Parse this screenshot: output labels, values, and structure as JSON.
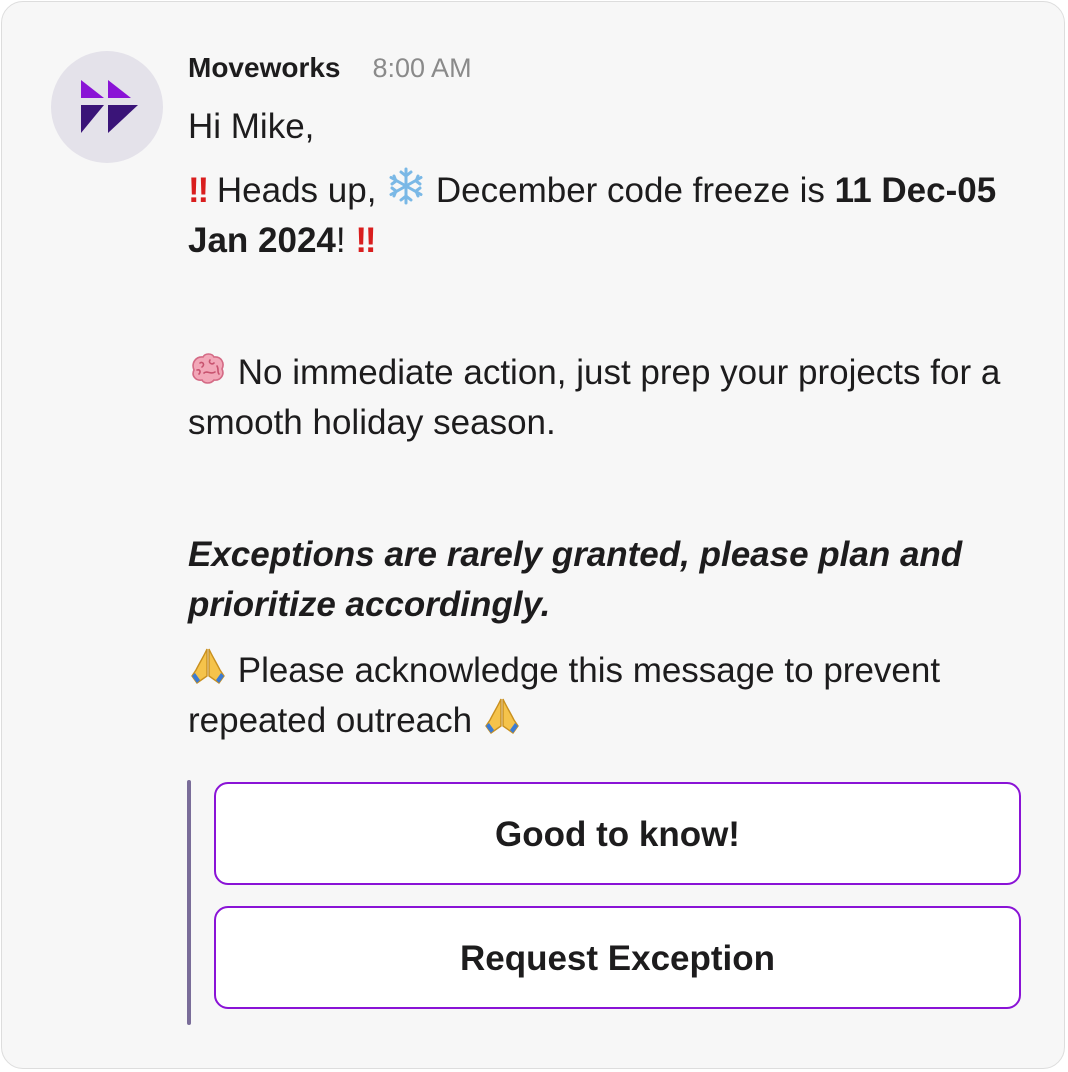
{
  "message": {
    "sender": "Moveworks",
    "time": "8:00 AM",
    "greeting": "Hi Mike,",
    "heads_up": {
      "bang": "‼",
      "text_before": " Heads up, ",
      "emoji_snowflake": "snowflake-icon",
      "text_middle": " December code freeze is ",
      "bold_dates": "11 Dec-05 Jan 2024",
      "text_after": "! "
    },
    "brain_line": {
      "emoji": "brain-icon",
      "text": " No immediate action, just prep your projects for a smooth holiday season."
    },
    "exceptions": "Exceptions are rarely granted, please plan and prioritize accordingly.",
    "acknowledge": {
      "emoji": "folded-hands-icon",
      "text": " Please acknowledge this message to prevent repeated outreach "
    }
  },
  "buttons": {
    "good_to_know": "Good to know!",
    "request_exception": "Request Exception"
  },
  "colors": {
    "brand_purple": "#8a13d6",
    "avatar_bg": "#e4e2ea",
    "alert_red": "#d91e1e",
    "attachment_bar": "#7a6d99"
  }
}
